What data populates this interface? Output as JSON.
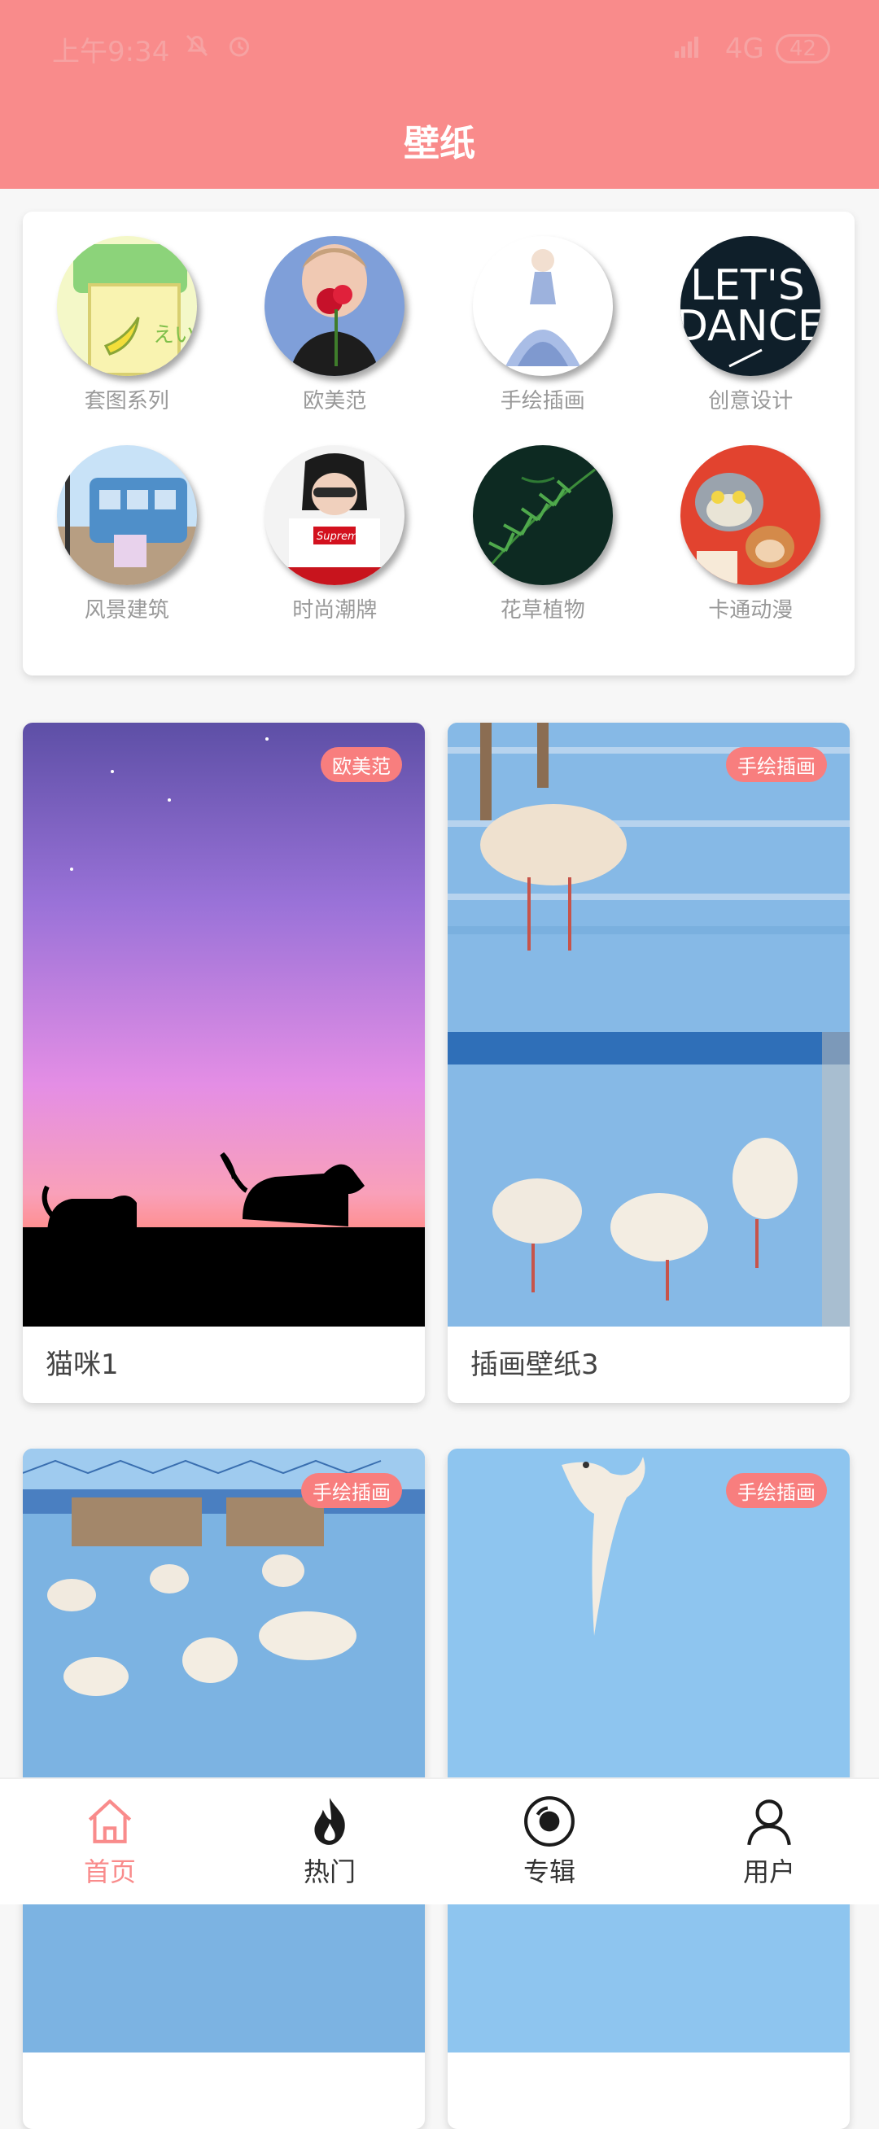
{
  "status": {
    "time": "上午9:34",
    "network": "4G",
    "battery": "42"
  },
  "header": {
    "title": "壁纸"
  },
  "categories": [
    {
      "label": "套图系列"
    },
    {
      "label": "欧美范"
    },
    {
      "label": "手绘插画"
    },
    {
      "label": "创意设计",
      "image_text": "LET'S DANCE"
    },
    {
      "label": "风景建筑"
    },
    {
      "label": "时尚潮牌",
      "image_text": "Supreme"
    },
    {
      "label": "花草植物"
    },
    {
      "label": "卡通动漫"
    }
  ],
  "wallpapers": [
    {
      "name": "猫咪1",
      "tag": "欧美范"
    },
    {
      "name": "插画壁纸3",
      "tag": "手绘插画"
    },
    {
      "name": "",
      "tag": "手绘插画"
    },
    {
      "name": "",
      "tag": "手绘插画"
    }
  ],
  "tabs": [
    {
      "label": "首页",
      "icon": "home-icon"
    },
    {
      "label": "热门",
      "icon": "fire-icon"
    },
    {
      "label": "专辑",
      "icon": "album-icon"
    },
    {
      "label": "用户",
      "icon": "user-icon"
    }
  ],
  "colors": {
    "accent": "#f98b8b",
    "badge": "#f87e7e"
  }
}
